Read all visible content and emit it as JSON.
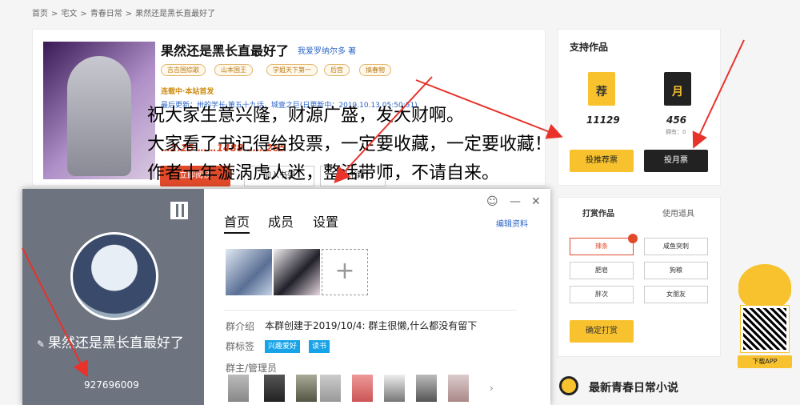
{
  "breadcrumb": [
    "首页",
    ">",
    "宅文",
    ">",
    "青春日常",
    ">",
    "果然还是黑长直最好了"
  ],
  "book": {
    "title": "果然还是黑长直最好了",
    "author": "我爱罗纳尔多 著",
    "tags": [
      "吉吉国综歌",
      "山本国王",
      "学姐天下第一",
      "后宫",
      "搞春物"
    ],
    "status": "连载中·本站首发",
    "updated": "最后更新：卅的学长·第五十九话，城壹之巨(日更新中：2019.10.13 05:50:51)",
    "stats": "…2.25 ……1488 ……265",
    "read_label": "立即阅读",
    "btn2_label": "加入书架",
    "btn3_label": "投书籍"
  },
  "overlay_text": [
    "祝大家生意兴隆，财源广盛，发大财啊。",
    "大家看了书记得给投票，一定要收藏，一定要收藏！",
    "作者十年漩涡虎人迷，整活带师，不请自来。"
  ],
  "support": {
    "title": "支持作品",
    "rec": {
      "symbol": "荐",
      "count": "11129",
      "button": "投推荐票"
    },
    "month": {
      "symbol": "月",
      "count": "456",
      "owned": "拥有：0",
      "button": "投月票"
    }
  },
  "reward": {
    "tabs": [
      "打赏作品",
      "使用道具"
    ],
    "gifts": [
      "辣条",
      "咸鱼突刺",
      "肥皂",
      "狗粮",
      "胖次",
      "女朋友"
    ],
    "confirm": "确定打赏"
  },
  "app": {
    "download": "下载APP"
  },
  "latest": {
    "title": "最新青春日常小说"
  },
  "qq": {
    "group_name": "果然还是黑长直最好了",
    "group_id": "927696009",
    "tabs": [
      "首页",
      "成员",
      "设置"
    ],
    "edit": "编辑资料",
    "win": {
      "face": "☺",
      "min": "—",
      "close": "✕"
    },
    "intro_label": "群介绍",
    "intro": "本群创建于2019/10/4: 群主很懒,什么都没有留下",
    "tag_label": "群标签",
    "tags": [
      "兴趣爱好",
      "读书"
    ],
    "admin_label": "群主/管理员",
    "add": "+"
  },
  "colors": {
    "accent_red": "#e04a2a",
    "accent_yellow": "#f7c22e",
    "link_blue": "#2b65c6",
    "arrow_red": "#e8322a"
  }
}
